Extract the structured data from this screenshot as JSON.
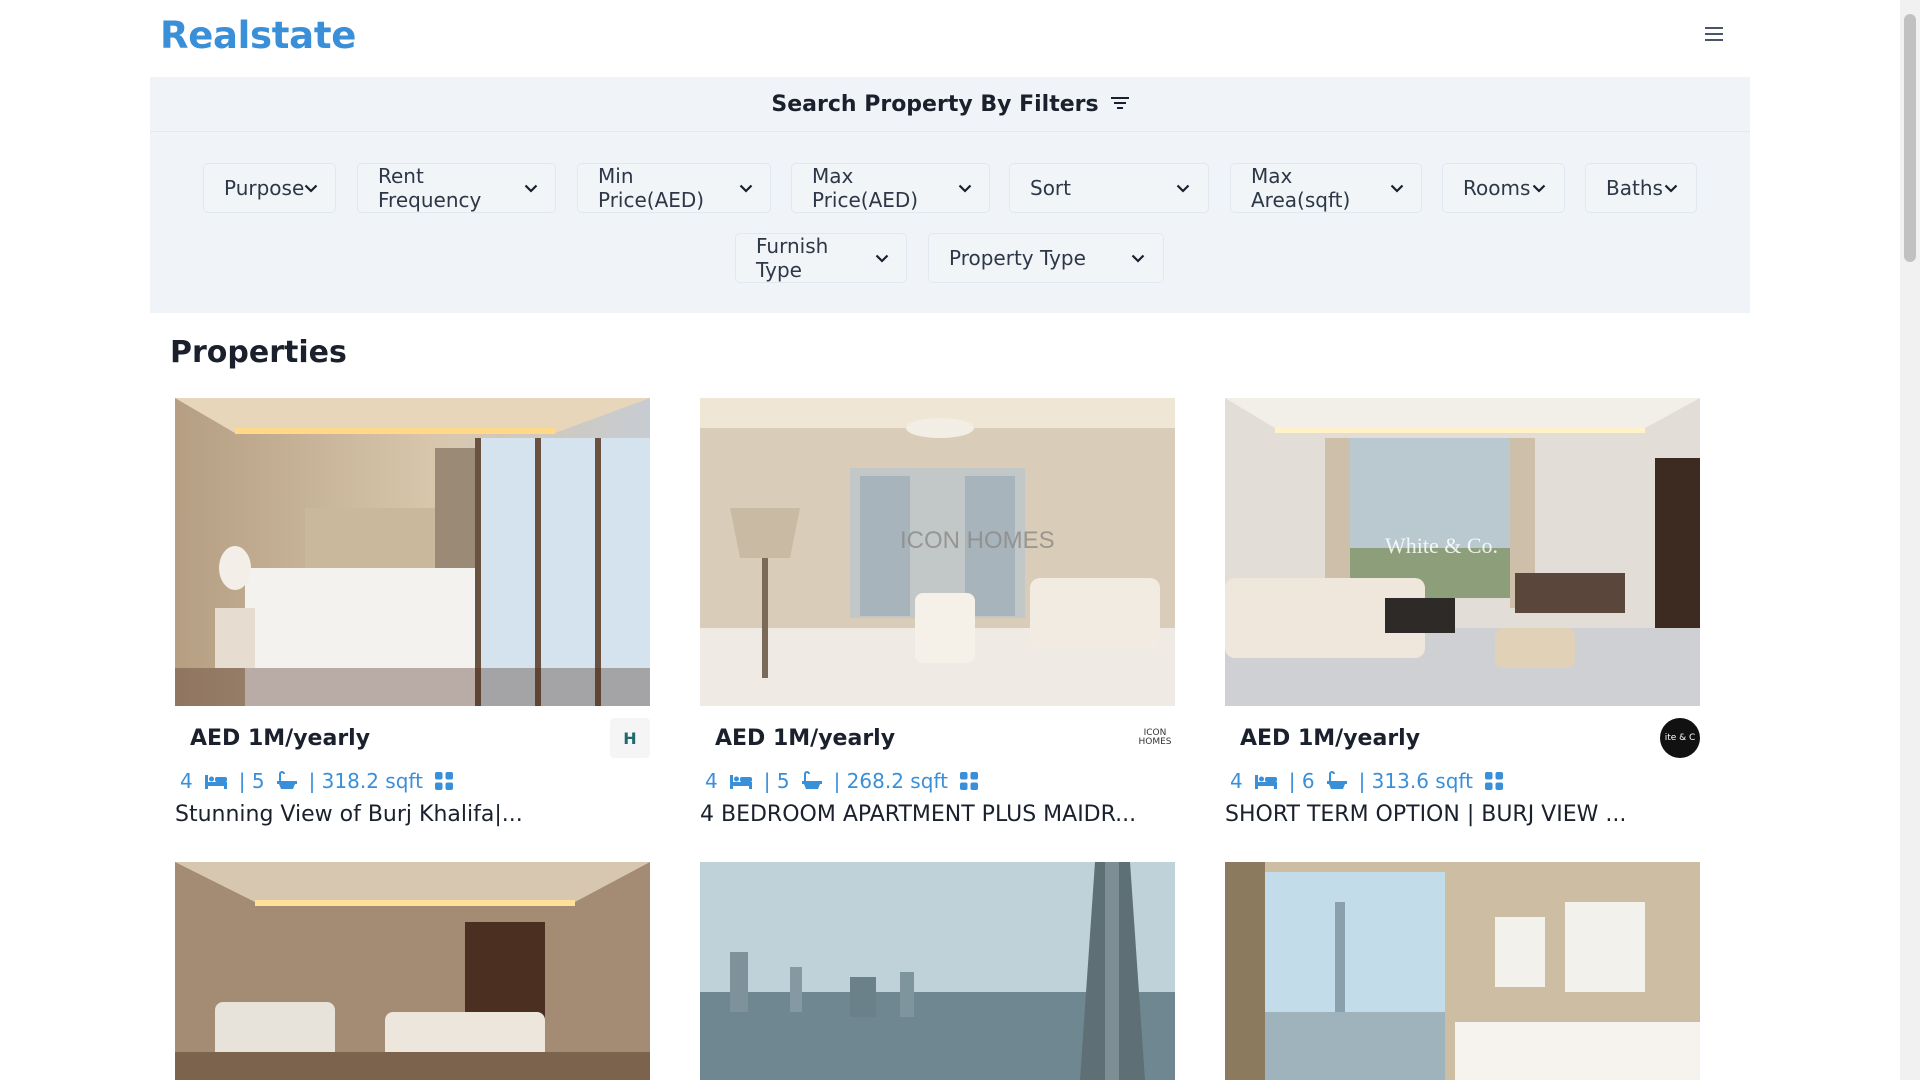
{
  "brand": {
    "logo": "Realstate"
  },
  "filters": {
    "title": "Search Property By Filters",
    "row1": [
      "Purpose",
      "Rent Frequency",
      "Min Price(AED)",
      "Max Price(AED)",
      "Sort",
      "Max Area(sqft)",
      "Rooms",
      "Baths"
    ],
    "row2": [
      "Furnish Type",
      "Property Type"
    ]
  },
  "section": {
    "title": "Properties"
  },
  "cards": [
    {
      "price": "AED 1M/yearly",
      "rooms": "4",
      "baths": "| 5",
      "area": "| 318.2 sqft",
      "title": "Stunning View of Burj Khalifa|...",
      "agency": "H"
    },
    {
      "price": "AED 1M/yearly",
      "rooms": "4",
      "baths": "| 5",
      "area": "| 268.2 sqft",
      "title": "4 BEDROOM APARTMENT PLUS MAIDR...",
      "agency": "ICON HOMES"
    },
    {
      "price": "AED 1M/yearly",
      "rooms": "4",
      "baths": "| 6",
      "area": "| 313.6 sqft",
      "title": "SHORT TERM OPTION | BURJ VIEW ...",
      "agency": "ite & C"
    },
    {
      "price": "",
      "rooms": "",
      "baths": "",
      "area": "",
      "title": "",
      "agency": ""
    },
    {
      "price": "",
      "rooms": "",
      "baths": "",
      "area": "",
      "title": "",
      "agency": ""
    },
    {
      "price": "",
      "rooms": "",
      "baths": "",
      "area": "",
      "title": "",
      "agency": ""
    }
  ],
  "watermarks": {
    "card2": "ICON HOMES",
    "card3": "White & Co."
  },
  "colors": {
    "brand": "#3a8fd9",
    "panel": "#f0f4f8"
  }
}
